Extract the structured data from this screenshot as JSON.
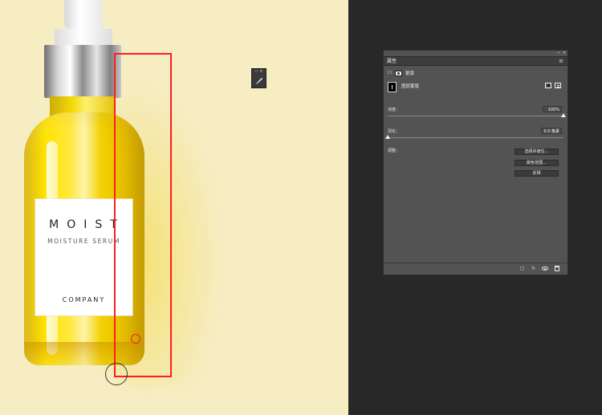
{
  "canvas": {
    "label_brand": "MOIST",
    "label_subtitle": "MOISTURE SERUM",
    "label_company": "COMPANY"
  },
  "floating_tool": {
    "control_text": "‹‹ ×",
    "icon": "brush-icon"
  },
  "properties_panel": {
    "window_controls": [
      "‹‹",
      "×"
    ],
    "tab_label": "属性",
    "menu_icon": "≡",
    "mode_label": "蒙版",
    "layer_label": "图层蒙版",
    "density": {
      "label": "浓度：",
      "value": "100%",
      "fraction": 1.0
    },
    "feather": {
      "label": "羽化：",
      "value": "0.0 像素",
      "fraction": 0.0
    },
    "refine": {
      "label": "调整：",
      "buttons": [
        "选择并遮住...",
        "颜色范围...",
        "反相"
      ]
    },
    "footer_icons": [
      "selection-icon",
      "load-icon",
      "eye-icon",
      "trash-icon"
    ]
  },
  "colors": {
    "canvas_background": "#f6edc3",
    "workspace_background": "#282828",
    "panel_background": "#535353",
    "selection_red": "#ff1d1d",
    "serum_yellow": "#ffe500"
  }
}
